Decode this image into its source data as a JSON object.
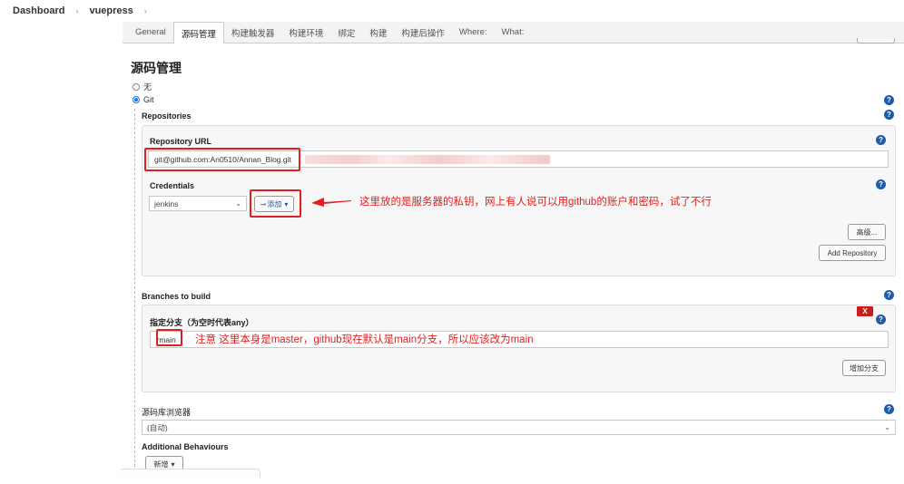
{
  "breadcrumb": {
    "items": [
      "Dashboard",
      "vuepress"
    ],
    "separator": "›"
  },
  "tabs": [
    "General",
    "源码管理",
    "构建触发器",
    "构建环境",
    "绑定",
    "构建",
    "构建后操作",
    "Where:",
    "What:"
  ],
  "active_tab_index": 1,
  "section_title": "源码管理",
  "scm": {
    "options": [
      "无",
      "Git"
    ],
    "selected": "Git",
    "repositories_label": "Repositories",
    "repository_url_label": "Repository URL",
    "repository_url_value": "git@github.com:An0510/Annan_Blog.git",
    "credentials_label": "Credentials",
    "credentials_value": "jenkins",
    "add_button_label": "添加",
    "advanced_button_label": "高级...",
    "add_repository_label": "Add Repository",
    "branches_label": "Branches to build",
    "branch_specifier_label": "指定分支（为空时代表any）",
    "branch_value": "main",
    "branch_prefix": "*",
    "delete_branch_label": "X",
    "add_branch_label": "增加分支",
    "browser_label": "源码库浏览器",
    "browser_value": "(自动)",
    "additional_behaviours_label": "Additional Behaviours",
    "new_button_label": "新增"
  },
  "annotations": {
    "credentials_note": "这里放的是服务器的私钥，网上有人说可以用github的账户和密码，试了不行",
    "branch_note": "注意 这里本身是master，github现在默认是main分支，所以应该改为main"
  },
  "help_icon_glyph": "?",
  "colors": {
    "annotation_red": "#e02020",
    "help_blue": "#1e5ba8",
    "radio_blue": "#1a73e8"
  }
}
